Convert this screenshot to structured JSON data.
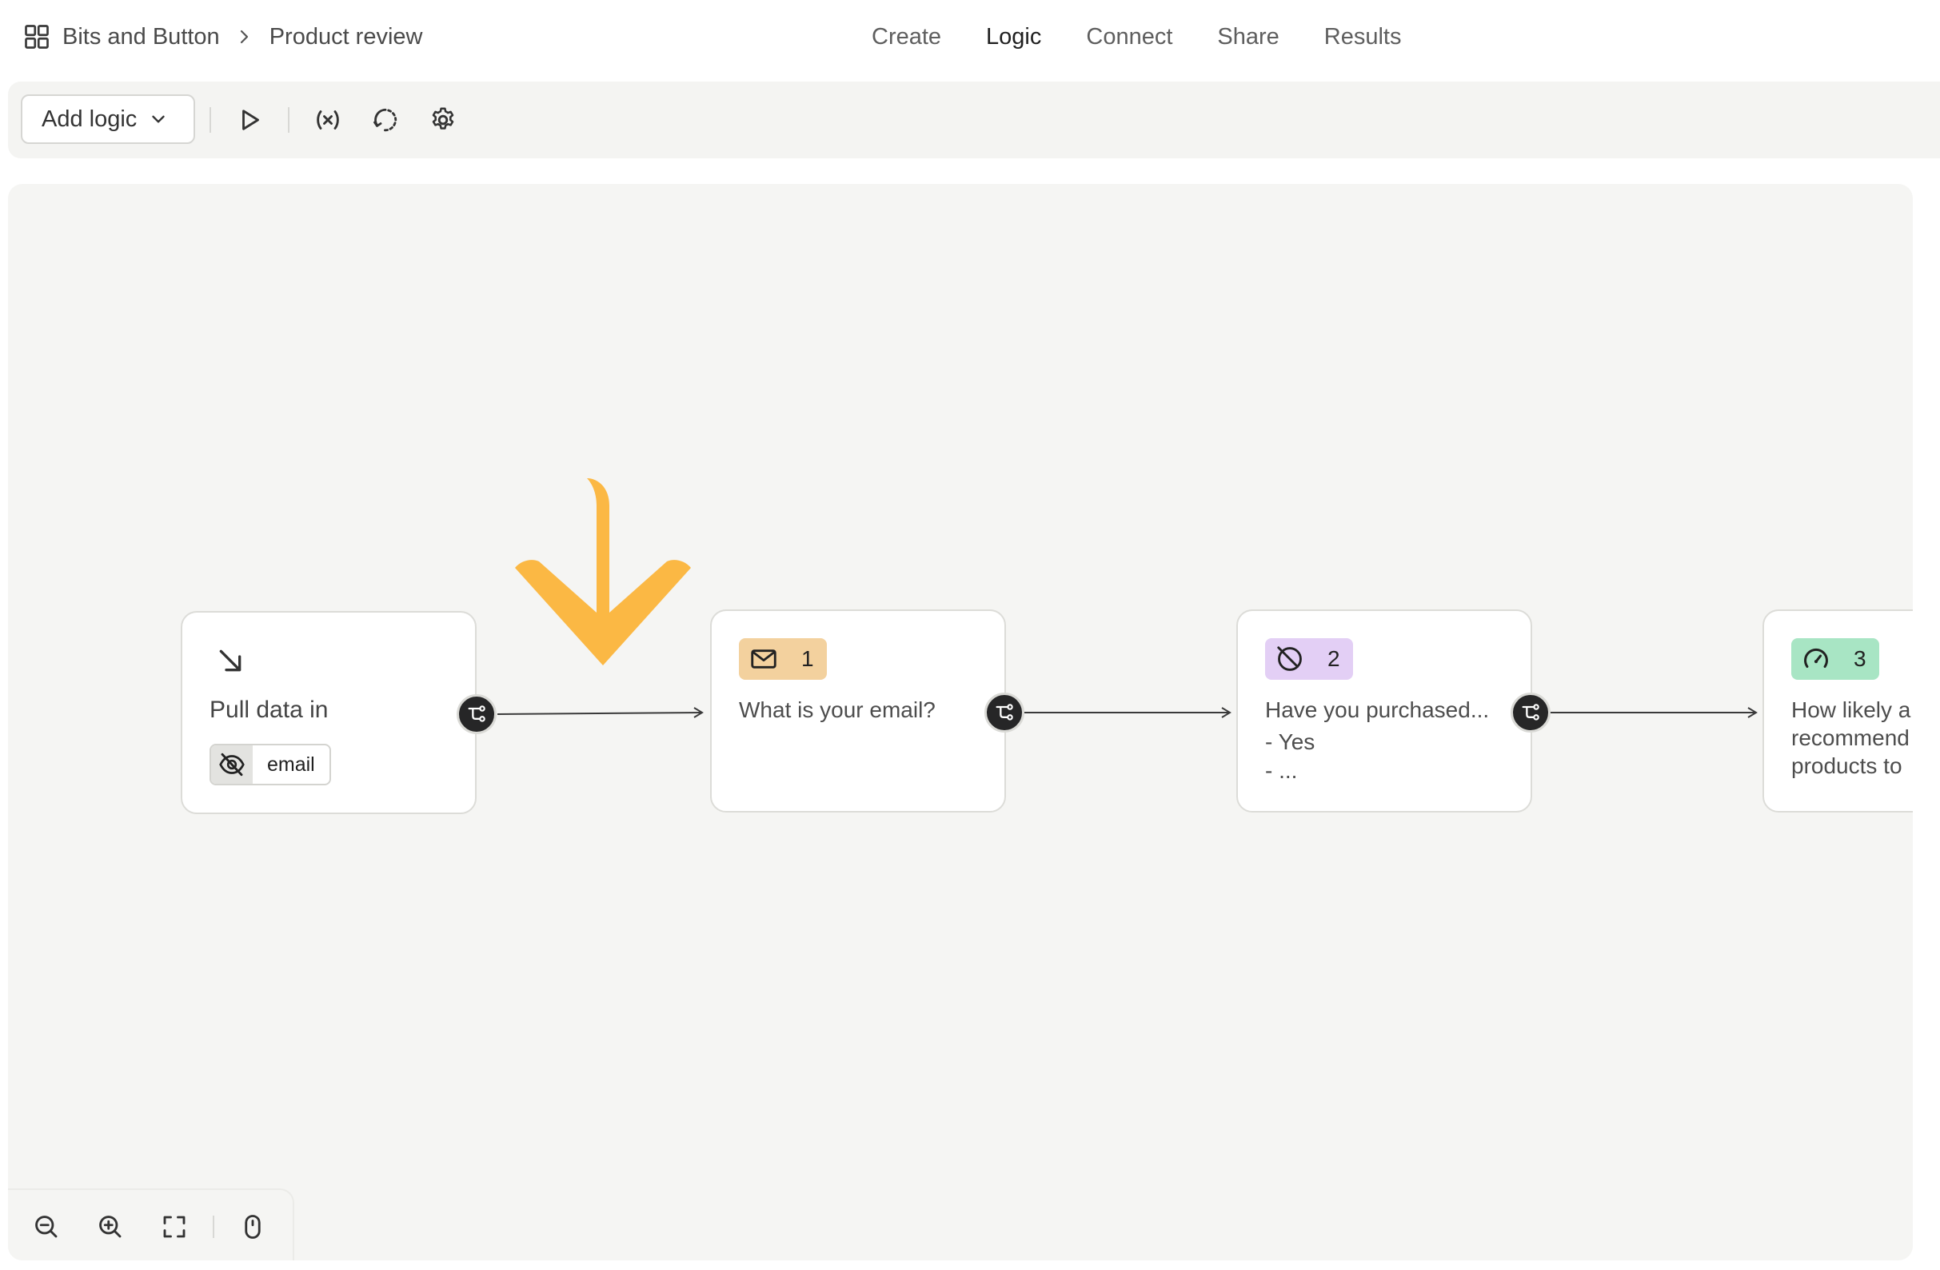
{
  "breadcrumb": {
    "workspace": "Bits and Button",
    "form": "Product review"
  },
  "nav": {
    "items": [
      "Create",
      "Logic",
      "Connect",
      "Share",
      "Results"
    ],
    "active": "Logic"
  },
  "toolbar": {
    "add_logic_label": "Add logic"
  },
  "nodes": {
    "pull_data": {
      "title": "Pull data in",
      "field": "email"
    },
    "q1": {
      "number": "1",
      "title": "What is your email?",
      "icon": "mail-icon",
      "color": "#f3d19e"
    },
    "q2": {
      "number": "2",
      "title": "Have you purchased...",
      "options": [
        "- Yes",
        "- ..."
      ],
      "icon": "not-allowed-icon",
      "color": "#e3cff5"
    },
    "q3": {
      "number": "3",
      "title_lines": [
        "How likely a",
        "recommend",
        "products to"
      ],
      "icon": "gauge-icon",
      "color": "#a8e5c4"
    }
  },
  "annotation": {
    "color": "#fbb844"
  },
  "accent": "#262627"
}
